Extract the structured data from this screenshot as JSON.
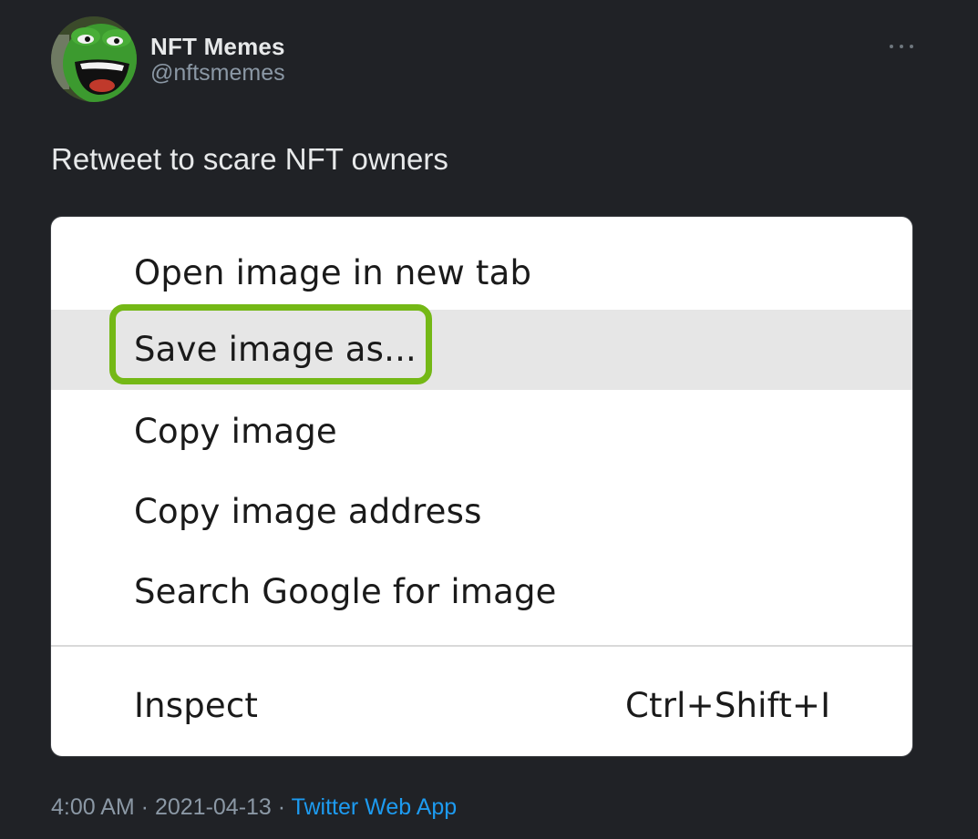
{
  "author": {
    "name": "NFT Memes",
    "handle": "@nftsmemes"
  },
  "tweet": {
    "text": "Retweet to scare NFT owners"
  },
  "media": {
    "menu_items": [
      {
        "label": "Open image in new tab"
      },
      {
        "label": "Save image as..."
      },
      {
        "label": "Copy image"
      },
      {
        "label": "Copy image address"
      },
      {
        "label": "Search Google for image"
      },
      {
        "label": "Inspect",
        "shortcut": "Ctrl+Shift+I"
      }
    ],
    "highlighted_item": "Save image as...",
    "highlight_color": "#74b816"
  },
  "footer": {
    "time": "4:00 AM",
    "sep1": " · ",
    "date": "2021-04-13",
    "sep2": " · ",
    "source": "Twitter Web App"
  },
  "colors": {
    "background": "#202226",
    "secondary_text": "#8b98a5",
    "link": "#1d9bf0"
  },
  "icons": {
    "more": "more-horizontal-icon"
  }
}
